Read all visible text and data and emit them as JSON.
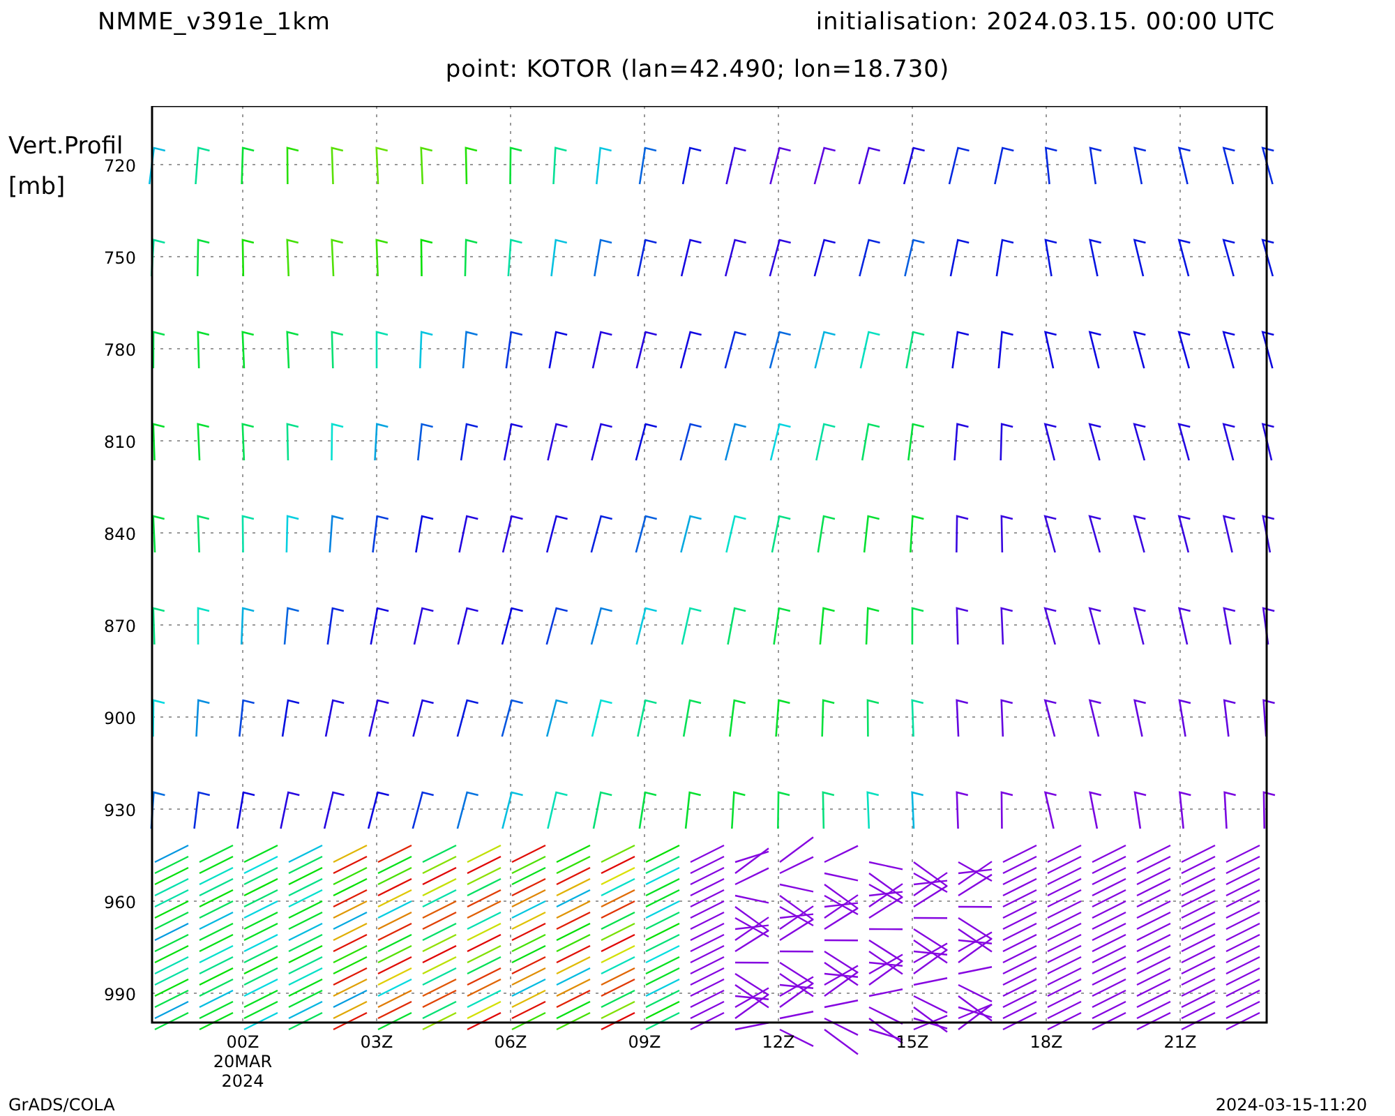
{
  "header": {
    "model": "NMME_v391e_1km",
    "initialisation": "initialisation: 2024.03.15. 00:00 UTC",
    "point": "point: KOTOR (lan=42.490; lon=18.730)"
  },
  "plot": {
    "y_title": "Vert.Profil",
    "y_unit": "[mb]",
    "y_labels": [
      "720",
      "750",
      "780",
      "810",
      "840",
      "870",
      "900",
      "930",
      "960",
      "990"
    ],
    "x_labels": [
      "00Z",
      "03Z",
      "06Z",
      "09Z",
      "12Z",
      "15Z",
      "18Z",
      "21Z"
    ],
    "date_labels": [
      "20MAR",
      "2024"
    ]
  },
  "footer": {
    "left": "GrADS/COLA",
    "right": "2024-03-15-11:20"
  }
}
